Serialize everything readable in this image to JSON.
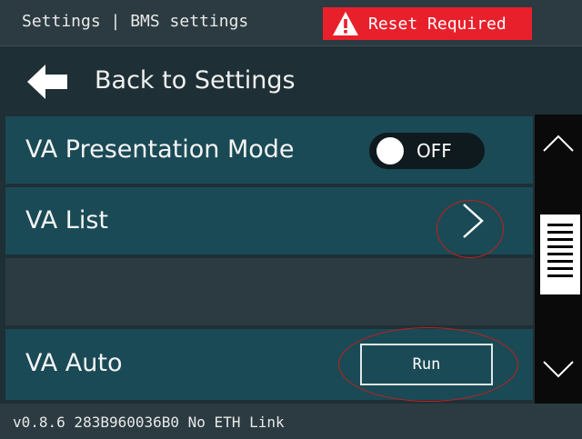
{
  "header": {
    "breadcrumb": "Settings | BMS settings",
    "alert": {
      "label": "Reset Required",
      "icon": "warning-icon",
      "color": "#e8202b"
    }
  },
  "back": {
    "label": "Back to Settings",
    "icon": "arrow-left-icon"
  },
  "rows": [
    {
      "label": "VA Presentation Mode",
      "control": "toggle",
      "state": "OFF"
    },
    {
      "label": "VA List",
      "control": "chevron-right-icon"
    },
    {
      "label": ""
    },
    {
      "label": "VA Auto",
      "control": "button",
      "button_label": "Run"
    }
  ],
  "scrollbar": {
    "up_icon": "chevron-up-icon",
    "down_icon": "chevron-down-icon"
  },
  "footer": {
    "status": "v0.8.6 283B960036B0 No ETH Link"
  },
  "colors": {
    "row_bg": "#1a4a55",
    "panel_bg": "#1e2f35",
    "bar_bg": "#2b3b41",
    "annotation": "#c0201e"
  }
}
